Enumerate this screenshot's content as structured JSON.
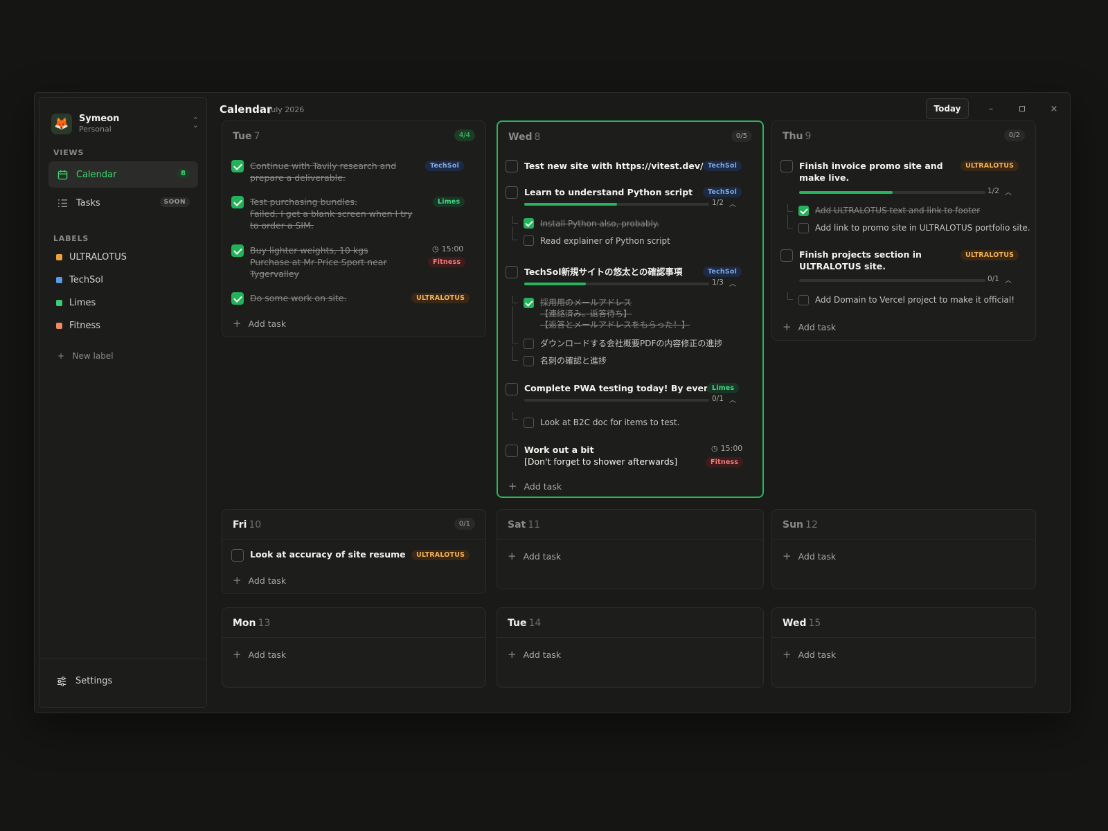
{
  "account": {
    "name": "Symeon",
    "type": "Personal"
  },
  "sidebar": {
    "views_title": "VIEWS",
    "views": [
      {
        "label": "Calendar",
        "badge": "8",
        "icon": "calendar-icon",
        "active": true
      },
      {
        "label": "Tasks",
        "badge": "SOON",
        "icon": "list-icon",
        "active": false
      }
    ],
    "labels_title": "LABELS",
    "labels": [
      {
        "label": "ULTRALOTUS",
        "color": "#f0a23a"
      },
      {
        "label": "TechSol",
        "color": "#5b9ae6"
      },
      {
        "label": "Limes",
        "color": "#3dcc73"
      },
      {
        "label": "Fitness",
        "color": "#f08a60"
      }
    ],
    "new_label": "New label",
    "settings": "Settings"
  },
  "header": {
    "title": "Calendar",
    "subtitle": "July 2026",
    "today_button": "Today"
  },
  "days": {
    "tue7": {
      "name": "Tue",
      "num": "7",
      "count": "4/4",
      "tasks": [
        {
          "text": "Continue with Tavily research and prepare a deliverable.",
          "tag": "TechSol",
          "done": true
        },
        {
          "text": "Test purchasing bundles.",
          "note": "Failed. I get a blank screen when I try to order a SIM.",
          "tag": "Limes",
          "done": true
        },
        {
          "text": "Buy lighter weights, 10 kgs",
          "note": "Purchase at Mr Price Sport near Tygervalley",
          "time": "15:00",
          "tag": "Fitness",
          "done": true
        },
        {
          "text": "Do some work on site.",
          "tag": "ULTRALOTUS",
          "done": true
        }
      ]
    },
    "wed8": {
      "name": "Wed",
      "num": "8",
      "count": "0/5",
      "tasks": [
        {
          "text": "Test new site with https://vitest.dev/",
          "tag": "TechSol"
        },
        {
          "text": "Learn to understand Python script",
          "tag": "TechSol",
          "progress": "1/2",
          "progress_value": 0.5,
          "subtasks": [
            {
              "text": "Install Python also, probably.",
              "done": true
            },
            {
              "text": "Read explainer of Python script",
              "done": false
            }
          ]
        },
        {
          "text": "TechSol新規サイトの悠太との確認事項",
          "tag": "TechSol",
          "progress": "1/3",
          "progress_value": 0.333,
          "subtasks": [
            {
              "text": "採用用のメールアドレス",
              "line2": "【連絡済み。返答待ち】",
              "line3": "【返答とメールアドレスをもらった！】",
              "done": true
            },
            {
              "text": "ダウンロードする会社概要PDFの内容修正の進捗",
              "done": false
            },
            {
              "text": "名刺の確認と進捗",
              "done": false
            }
          ]
        },
        {
          "text": "Complete PWA testing today! By evening.",
          "tag": "Limes",
          "progress": "0/1",
          "progress_value": 0,
          "subtasks": [
            {
              "text": "Look at B2C doc for items to test.",
              "done": false
            }
          ]
        },
        {
          "text": "Work out a bit",
          "note": "[Don't forget to shower afterwards]",
          "time": "15:00",
          "tag": "Fitness"
        }
      ]
    },
    "thu9": {
      "name": "Thu",
      "num": "9",
      "count": "0/2",
      "tasks": [
        {
          "text": "Finish invoice promo site and make live.",
          "tag": "ULTRALOTUS",
          "progress": "1/2",
          "progress_value": 0.5,
          "subtasks": [
            {
              "text": "Add ULTRALOTUS text and link to footer",
              "done": true
            },
            {
              "text": "Add link to promo site in ULTRALOTUS portfolio site.",
              "done": false
            }
          ]
        },
        {
          "text": "Finish projects section in ULTRALOTUS site.",
          "tag": "ULTRALOTUS",
          "progress": "0/1",
          "progress_value": 0,
          "subtasks": [
            {
              "text": "Add Domain to Vercel project to make it official!",
              "done": false
            }
          ]
        }
      ]
    },
    "fri10": {
      "name": "Fri",
      "num": "10",
      "count": "0/1",
      "tasks": [
        {
          "text": "Look at accuracy of site resume",
          "tag": "ULTRALOTUS"
        }
      ]
    },
    "sat11": {
      "name": "Sat",
      "num": "11"
    },
    "sun12": {
      "name": "Sun",
      "num": "12"
    },
    "mon13": {
      "name": "Mon",
      "num": "13"
    },
    "tue14": {
      "name": "Tue",
      "num": "14"
    },
    "wed15": {
      "name": "Wed",
      "num": "15"
    }
  },
  "add_task": "Add task"
}
